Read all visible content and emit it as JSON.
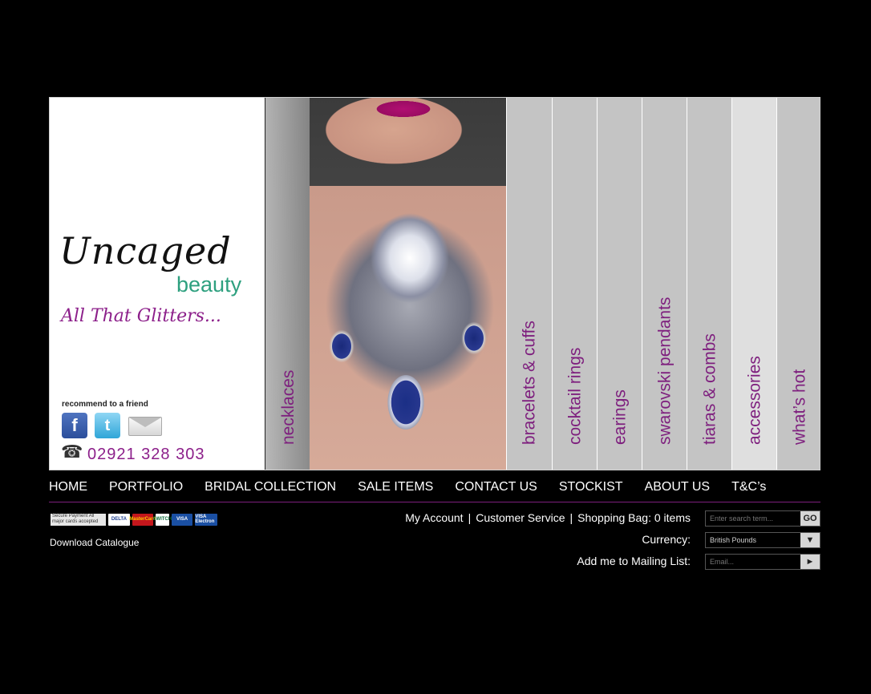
{
  "brand": {
    "logo_script": "Uncaged",
    "logo_beauty": "beauty",
    "tagline": "All That Glitters...",
    "recommend": "recommend to a friend",
    "phone": "02921 328 303"
  },
  "categories": [
    {
      "label": "necklaces"
    },
    {
      "label": "bracelets & cuffs"
    },
    {
      "label": "cocktail rings"
    },
    {
      "label": "earings"
    },
    {
      "label": "swarovski pendants"
    },
    {
      "label": "tiaras & combs"
    },
    {
      "label": "accessories"
    },
    {
      "label": "what’s hot"
    }
  ],
  "nav": [
    "HOME",
    "PORTFOLIO",
    "BRIDAL COLLECTION",
    "SALE ITEMS",
    "CONTACT US",
    "STOCKIST",
    "ABOUT US",
    "T&C’s"
  ],
  "payment": {
    "secure_text": "Secure Payment All major cards accepted",
    "cards": [
      "DELTA",
      "MasterCard",
      "SWITCH",
      "VISA",
      "VISA Electron"
    ]
  },
  "download_catalogue": "Download Catalogue",
  "account": {
    "my_account": "My Account",
    "customer_service": "Customer Service",
    "shopping_bag": "Shopping Bag: 0 items",
    "separator": "|"
  },
  "search": {
    "placeholder": "Enter search term...",
    "button": "GO"
  },
  "currency": {
    "label": "Currency:",
    "value": "British Pounds",
    "arrow": "▼"
  },
  "mailing": {
    "label": "Add me to Mailing List:",
    "placeholder": "Email...",
    "arrow": "►"
  },
  "colors": {
    "brand_purple": "#7e1f7e",
    "brand_teal": "#2ea07f"
  }
}
